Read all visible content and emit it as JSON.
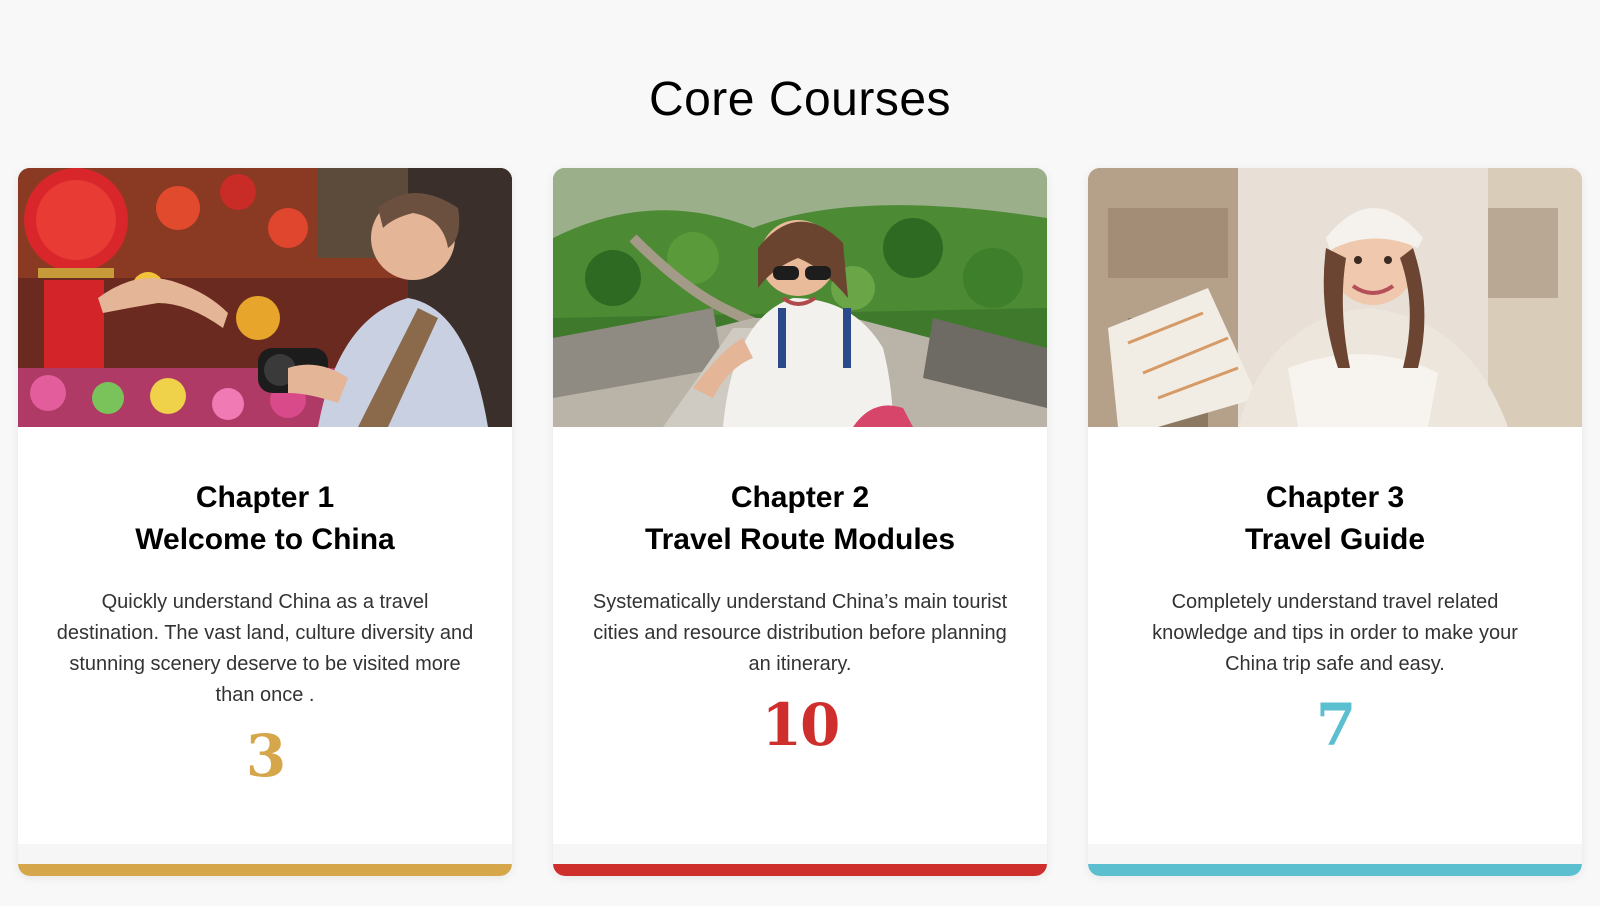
{
  "section": {
    "title": "Core Courses"
  },
  "courses": [
    {
      "chapter": "Chapter 1",
      "name": "Welcome to China",
      "description": "Quickly understand China as a travel destination. The vast land, culture diversity and stunning scenery deserve to be visited more than once .",
      "count": "3",
      "accent": "#d6a74a",
      "image": "tourist-with-camera-at-market-photo"
    },
    {
      "chapter": "Chapter 2",
      "name": "Travel Route Modules",
      "description": "Systematically understand China’s main tourist cities and resource distribution before planning an itinerary.",
      "count": "10",
      "accent": "#cf2f2c",
      "image": "woman-on-great-wall-photo"
    },
    {
      "chapter": "Chapter 3",
      "name": "Travel Guide",
      "description": "Completely understand travel related knowledge and tips in order to make your China trip safe and easy.",
      "count": "7",
      "accent": "#5bbfd0",
      "image": "woman-with-map-in-old-town-photo"
    }
  ]
}
